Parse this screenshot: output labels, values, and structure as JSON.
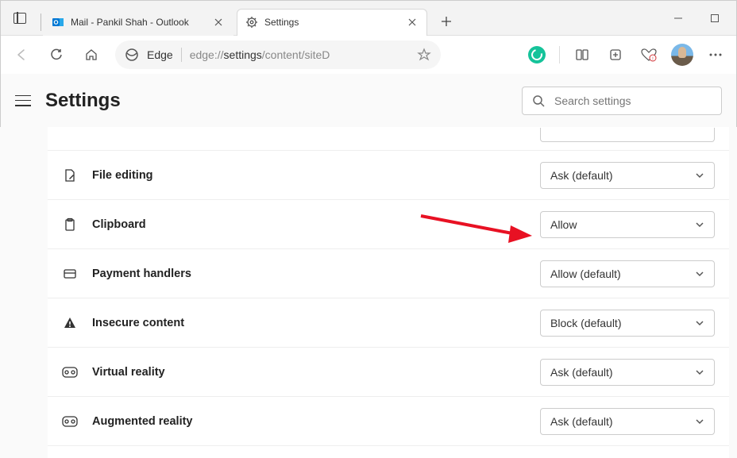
{
  "tabs": [
    {
      "title": "Mail - Pankil Shah - Outlook",
      "favicon": "outlook"
    },
    {
      "title": "Settings",
      "favicon": "gear"
    }
  ],
  "omnibox": {
    "brand": "Edge",
    "url_prefix": "edge://",
    "url_dark": "settings",
    "url_suffix": "/content/siteD"
  },
  "settings": {
    "title": "Settings",
    "search_placeholder": "Search settings"
  },
  "permissions": [
    {
      "icon": "file",
      "label": "File editing",
      "value": "Ask (default)"
    },
    {
      "icon": "clipboard",
      "label": "Clipboard",
      "value": "Allow"
    },
    {
      "icon": "card",
      "label": "Payment handlers",
      "value": "Allow (default)"
    },
    {
      "icon": "warning",
      "label": "Insecure content",
      "value": "Block (default)"
    },
    {
      "icon": "vr",
      "label": "Virtual reality",
      "value": "Ask (default)"
    },
    {
      "icon": "vr",
      "label": "Augmented reality",
      "value": "Ask (default)"
    }
  ]
}
